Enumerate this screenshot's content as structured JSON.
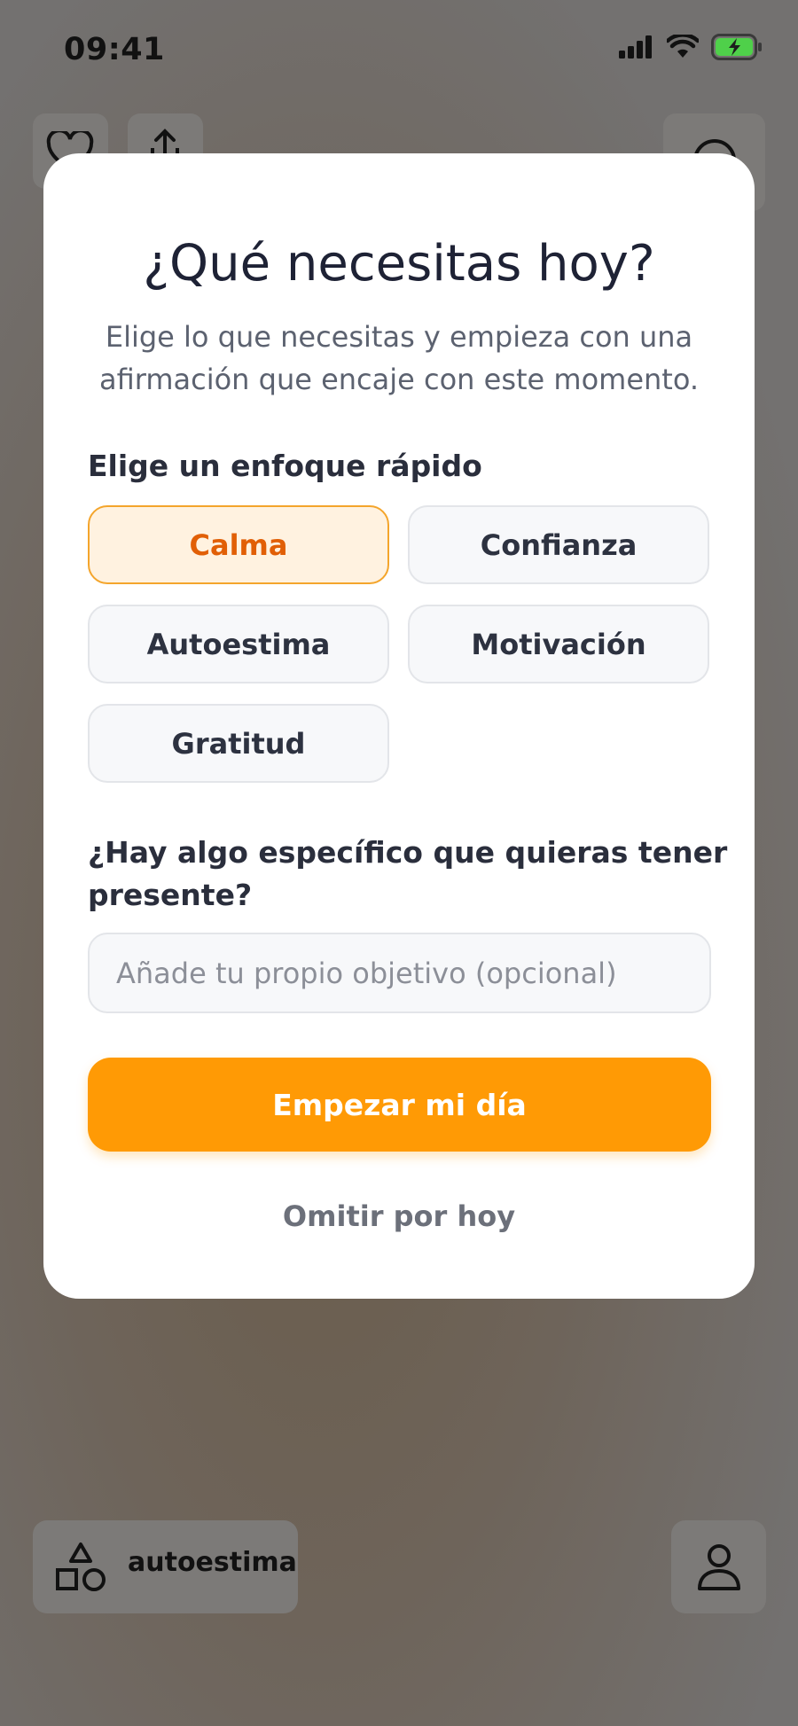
{
  "status": {
    "time": "09:41"
  },
  "modal": {
    "title": "¿Qué necesitas hoy?",
    "subtitle_line1": "Elige lo que necesitas y empieza con una",
    "subtitle_line2": "afirmación que encaje con este momento.",
    "focus_label": "Elige un enfoque rápido",
    "chips": [
      {
        "label": "Calma",
        "selected": true
      },
      {
        "label": "Confianza",
        "selected": false
      },
      {
        "label": "Autoestima",
        "selected": false
      },
      {
        "label": "Motivación",
        "selected": false
      },
      {
        "label": "Gratitud",
        "selected": false
      }
    ],
    "specific_label_line1": "¿Hay algo específico que quieras tener",
    "specific_label_line2": "presente?",
    "goal_placeholder": "Añade tu propio objetivo (opcional)",
    "start_button": "Empezar mi día",
    "skip_link": "Omitir por hoy"
  },
  "bottom_bar": {
    "category_label": "autoestima"
  },
  "colors": {
    "accent": "#ff9a05",
    "selected_chip_text": "#e15f06",
    "selected_chip_bg": "#fff2e0"
  }
}
